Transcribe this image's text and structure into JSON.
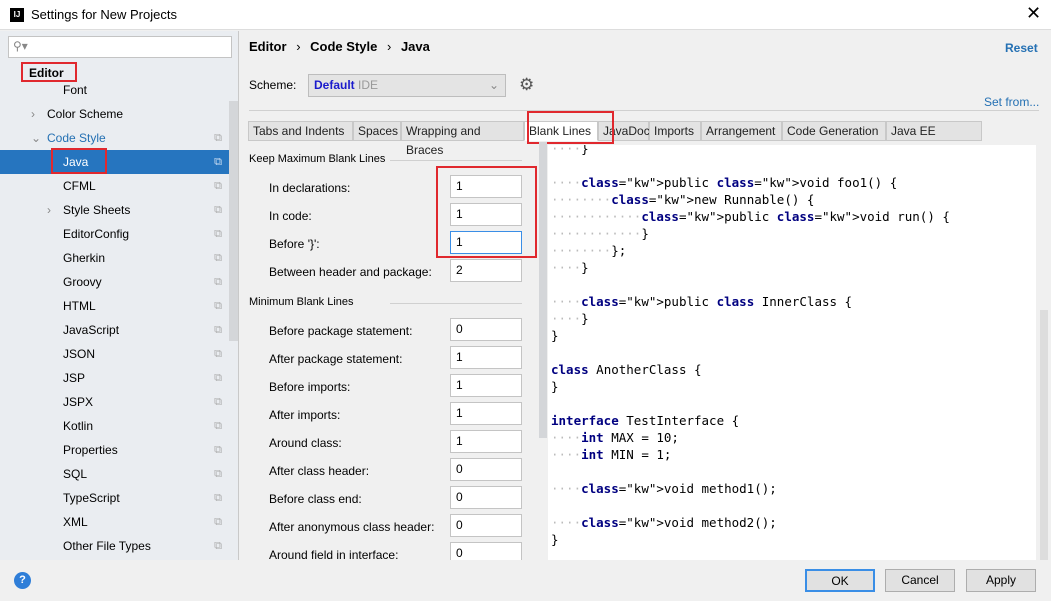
{
  "window": {
    "title": "Settings for New Projects"
  },
  "search": {
    "placeholder": ""
  },
  "sidebar": {
    "items": [
      {
        "label": "Editor",
        "level": 0,
        "bold": true
      },
      {
        "label": "Font",
        "level": 2
      },
      {
        "label": "Color Scheme",
        "level": 1,
        "expander": "collapsed"
      },
      {
        "label": "Code Style",
        "level": 1,
        "expander": "expanded",
        "link": true,
        "copy": true
      },
      {
        "label": "Java",
        "level": 2,
        "selected": true,
        "copy": true
      },
      {
        "label": "CFML",
        "level": 2,
        "copy": true
      },
      {
        "label": "Style Sheets",
        "level": 2,
        "expander": "collapsed",
        "copy": true
      },
      {
        "label": "EditorConfig",
        "level": 2,
        "copy": true
      },
      {
        "label": "Gherkin",
        "level": 2,
        "copy": true
      },
      {
        "label": "Groovy",
        "level": 2,
        "copy": true
      },
      {
        "label": "HTML",
        "level": 2,
        "copy": true
      },
      {
        "label": "JavaScript",
        "level": 2,
        "copy": true
      },
      {
        "label": "JSON",
        "level": 2,
        "copy": true
      },
      {
        "label": "JSP",
        "level": 2,
        "copy": true
      },
      {
        "label": "JSPX",
        "level": 2,
        "copy": true
      },
      {
        "label": "Kotlin",
        "level": 2,
        "copy": true
      },
      {
        "label": "Properties",
        "level": 2,
        "copy": true
      },
      {
        "label": "SQL",
        "level": 2,
        "copy": true
      },
      {
        "label": "TypeScript",
        "level": 2,
        "copy": true
      },
      {
        "label": "XML",
        "level": 2,
        "copy": true
      },
      {
        "label": "Other File Types",
        "level": 2,
        "copy": true
      }
    ]
  },
  "breadcrumb": [
    "Editor",
    "Code Style",
    "Java"
  ],
  "reset_label": "Reset",
  "scheme": {
    "label": "Scheme:",
    "value": "Default",
    "suffix": "IDE"
  },
  "set_from_label": "Set from...",
  "tabs": [
    "Tabs and Indents",
    "Spaces",
    "Wrapping and Braces",
    "Blank Lines",
    "JavaDoc",
    "Imports",
    "Arrangement",
    "Code Generation",
    "Java EE Names"
  ],
  "active_tab": "Blank Lines",
  "sections": [
    {
      "title": "Keep Maximum Blank Lines",
      "rows": [
        {
          "label": "In declarations:",
          "value": "1"
        },
        {
          "label": "In code:",
          "value": "1"
        },
        {
          "label": "Before '}':",
          "value": "1"
        },
        {
          "label": "Between header and package:",
          "value": "2"
        }
      ]
    },
    {
      "title": "Minimum Blank Lines",
      "rows": [
        {
          "label": "Before package statement:",
          "value": "0"
        },
        {
          "label": "After package statement:",
          "value": "1"
        },
        {
          "label": "Before imports:",
          "value": "1"
        },
        {
          "label": "After imports:",
          "value": "1"
        },
        {
          "label": "Around class:",
          "value": "1"
        },
        {
          "label": "After class header:",
          "value": "0"
        },
        {
          "label": "Before class end:",
          "value": "0"
        },
        {
          "label": "After anonymous class header:",
          "value": "0"
        },
        {
          "label": "Around field in interface:",
          "value": "0"
        }
      ]
    }
  ],
  "code": [
    "    }",
    "",
    "    public void foo1() {",
    "        new Runnable() {",
    "            public void run() {",
    "            }",
    "        };",
    "    }",
    "",
    "    public class InnerClass {",
    "    }",
    "}",
    "",
    "class AnotherClass {",
    "}",
    "",
    "interface TestInterface {",
    "    int MAX = 10;",
    "    int MIN = 1;",
    "",
    "    void method1();",
    "",
    "    void method2();",
    "}"
  ],
  "buttons": {
    "ok": "OK",
    "cancel": "Cancel",
    "apply": "Apply"
  },
  "colors": {
    "selection": "#2675bf",
    "link": "#2470b3",
    "keyword": "#000080",
    "highlight": "#e0282e"
  }
}
